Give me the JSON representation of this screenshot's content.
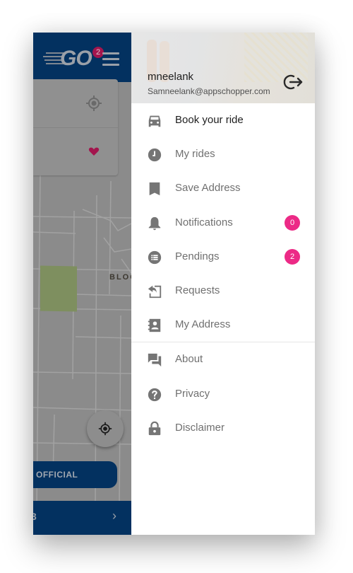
{
  "app": {
    "logo_text": "GO",
    "notification_count": "2",
    "map_label": "BLOC",
    "official_button_label": "OFFICIAL",
    "bottom_bar_text": "3",
    "bottom_bar_chevron": "›",
    "colors": {
      "brand_navy": "#033160",
      "badge_pink": "#ec2a86",
      "heart_red": "#a3154d"
    }
  },
  "drawer": {
    "user": {
      "name": "mneelank",
      "email": "Samneelank@appschopper.com"
    },
    "logout_icon": "logout-icon",
    "items": [
      {
        "label": "Book your ride",
        "icon": "car-icon",
        "active": true
      },
      {
        "label": "My rides",
        "icon": "clock-icon"
      },
      {
        "label": "Save Address",
        "icon": "bookmark-icon"
      },
      {
        "label": "Notifications",
        "icon": "bell-icon",
        "badge": "0"
      },
      {
        "label": "Pendings",
        "icon": "list-icon",
        "badge": "2"
      },
      {
        "label": "Requests",
        "icon": "reply-icon"
      },
      {
        "label": "My Address",
        "icon": "contact-book-icon"
      }
    ],
    "secondary_items": [
      {
        "label": "About",
        "icon": "chat-icon"
      },
      {
        "label": "Privacy",
        "icon": "help-icon"
      },
      {
        "label": "Disclaimer",
        "icon": "lock-icon"
      }
    ]
  }
}
